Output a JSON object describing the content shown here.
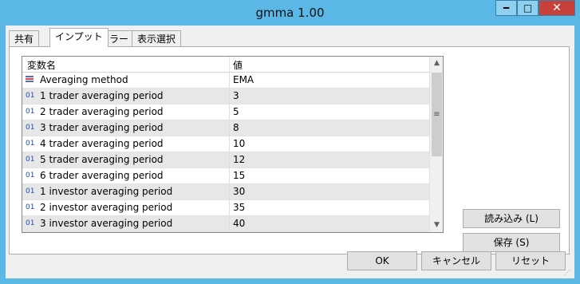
{
  "window": {
    "title": "gmma 1.00",
    "minimize_icon": "minimize-icon",
    "maximize_icon": "maximize-icon",
    "close_icon": "close-icon"
  },
  "tabs": [
    {
      "label": "共有",
      "active": false
    },
    {
      "label": "インプット",
      "active": true
    },
    {
      "label": "カラー",
      "active": false
    },
    {
      "label": "表示選択",
      "active": false
    }
  ],
  "grid": {
    "col_name": "変数名",
    "col_value": "値",
    "rows": [
      {
        "icon": "list-icon",
        "name": "Averaging method",
        "value": "EMA"
      },
      {
        "icon": "int-icon",
        "name": "1 trader averaging period",
        "value": "3"
      },
      {
        "icon": "int-icon",
        "name": "2 trader averaging period",
        "value": "5"
      },
      {
        "icon": "int-icon",
        "name": "3 trader averaging period",
        "value": "8"
      },
      {
        "icon": "int-icon",
        "name": "4 trader averaging period",
        "value": "10"
      },
      {
        "icon": "int-icon",
        "name": "5 trader averaging period",
        "value": "12"
      },
      {
        "icon": "int-icon",
        "name": "6 trader averaging period",
        "value": "15"
      },
      {
        "icon": "int-icon",
        "name": "1 investor averaging period",
        "value": "30"
      },
      {
        "icon": "int-icon",
        "name": "2 investor averaging period",
        "value": "35"
      },
      {
        "icon": "int-icon",
        "name": "3 investor averaging period",
        "value": "40"
      }
    ],
    "int_icon_text": "01"
  },
  "buttons": {
    "load": "読み込み (L)",
    "save": "保存 (S)",
    "ok": "OK",
    "cancel": "キャンセル",
    "reset": "リセット"
  },
  "colors": {
    "titlebar": "#5bb8e6",
    "close": "#c7413a"
  }
}
